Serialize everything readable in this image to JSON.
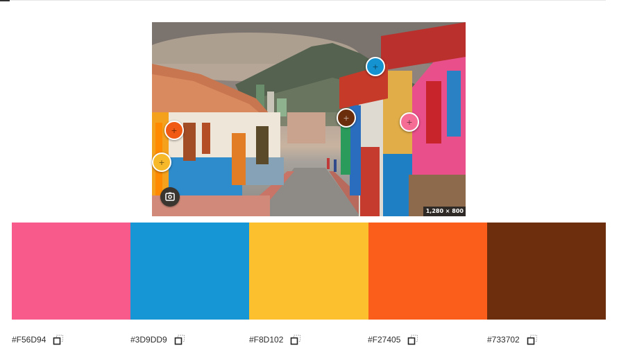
{
  "photo": {
    "dimensions_label": "1,280 × 800"
  },
  "markers": [
    {
      "name": "pink",
      "color": "#F56D94"
    },
    {
      "name": "blue",
      "color": "#3D9DD9"
    },
    {
      "name": "yellow",
      "color": "#F8D102"
    },
    {
      "name": "orange",
      "color": "#F27405"
    },
    {
      "name": "brown",
      "color": "#733702"
    }
  ],
  "palette": {
    "swatches": [
      {
        "hex": "#F56D94",
        "display": "#F95A8C"
      },
      {
        "hex": "#3D9DD9",
        "display": "#1696D4"
      },
      {
        "hex": "#F8D102",
        "display": "#FCC02E"
      },
      {
        "hex": "#F27405",
        "display": "#FB5E1A"
      },
      {
        "hex": "#733702",
        "display": "#6D2E0D"
      }
    ]
  },
  "icons": {
    "capture": "capture-icon",
    "copy": "copy-icon",
    "marker_plus": "+"
  }
}
